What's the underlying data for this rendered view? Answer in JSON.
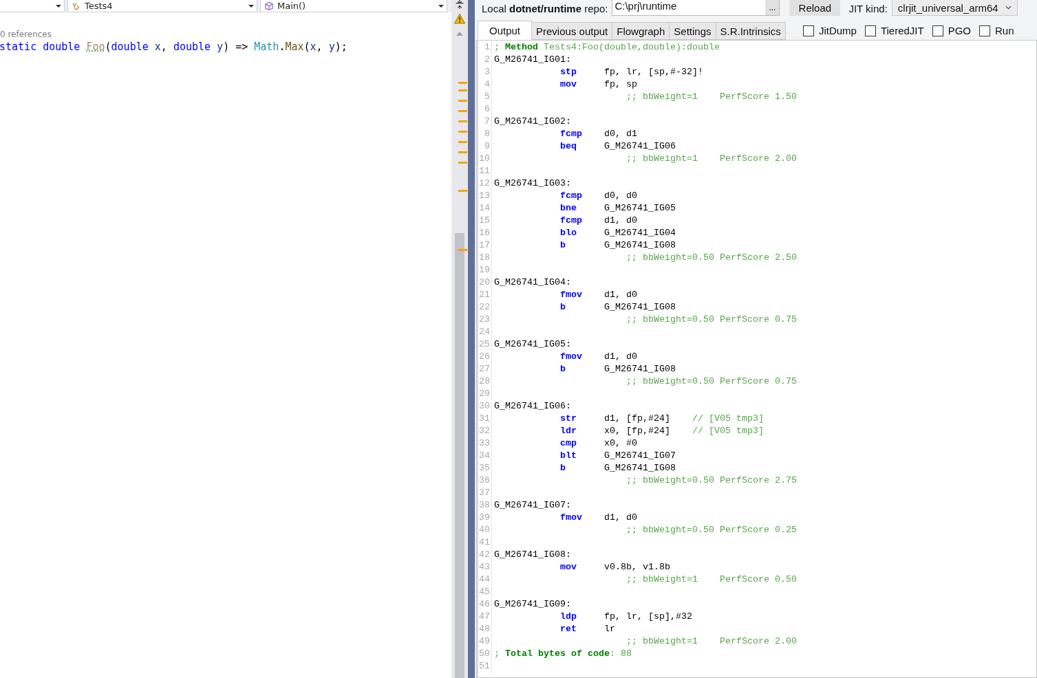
{
  "editor": {
    "nav": [
      {
        "label": "Tests4",
        "kind": "class"
      },
      {
        "label": "Main()",
        "kind": "method"
      }
    ],
    "codelens": "0 references",
    "code": [
      {
        "kind": "keyword",
        "text": "static double "
      },
      {
        "kind": "unused",
        "text": "Foo"
      },
      {
        "kind": "plain",
        "text": "("
      },
      {
        "kind": "keyword",
        "text": "double"
      },
      {
        "kind": "param",
        "text": " x"
      },
      {
        "kind": "plain",
        "text": ", "
      },
      {
        "kind": "keyword",
        "text": "double"
      },
      {
        "kind": "param",
        "text": " y"
      },
      {
        "kind": "plain",
        "text": ") => "
      },
      {
        "kind": "type",
        "text": "Math"
      },
      {
        "kind": "plain",
        "text": "."
      },
      {
        "kind": "method",
        "text": "Max"
      },
      {
        "kind": "plain",
        "text": "("
      },
      {
        "kind": "param",
        "text": "x"
      },
      {
        "kind": "plain",
        "text": ", "
      },
      {
        "kind": "param",
        "text": "y"
      },
      {
        "kind": "plain",
        "text": ");"
      }
    ]
  },
  "jit": {
    "repo_label": "Local **dotnet/runtime** repo:",
    "repo_value": "C:\\prj\\runtime",
    "browse": "...",
    "reload": "Reload",
    "jit_kind_label": "JIT kind:",
    "jit_kind": "clrjit_universal_arm64",
    "tabs": [
      {
        "label": "Output",
        "selected": true
      },
      {
        "label": "Previous output",
        "selected": false
      },
      {
        "label": "Flowgraph",
        "selected": false
      },
      {
        "label": "Settings",
        "selected": false
      },
      {
        "label": "S.R.Intrinsics",
        "selected": false
      }
    ],
    "options": [
      {
        "label": "JitDump",
        "checked": false
      },
      {
        "label": "TieredJIT",
        "checked": false
      },
      {
        "label": "PGO",
        "checked": false
      },
      {
        "label": "Run",
        "checked": false
      }
    ]
  },
  "listing": [
    {
      "num": "1",
      "kind": "header",
      "mark": ";",
      "keyword": "Method",
      "rest": " Tests4:Foo(double,double):double"
    },
    {
      "num": "2",
      "kind": "label",
      "text": "G_M26741_IG01:"
    },
    {
      "num": "3",
      "kind": "instr",
      "op": "stp",
      "args": "fp, lr, [sp,#-32]!"
    },
    {
      "num": "4",
      "kind": "instr",
      "op": "mov",
      "args": "fp, sp"
    },
    {
      "num": "5",
      "kind": "score",
      "text": ";; bbWeight=1    PerfScore 1.50"
    },
    {
      "num": "6",
      "kind": "blank"
    },
    {
      "num": "7",
      "kind": "label",
      "text": "G_M26741_IG02:"
    },
    {
      "num": "8",
      "kind": "instr",
      "op": "fcmp",
      "args": "d0, d1"
    },
    {
      "num": "9",
      "kind": "instr",
      "op": "beq",
      "args": "G_M26741_IG06"
    },
    {
      "num": "10",
      "kind": "score",
      "text": ";; bbWeight=1    PerfScore 2.00"
    },
    {
      "num": "11",
      "kind": "blank"
    },
    {
      "num": "12",
      "kind": "label",
      "text": "G_M26741_IG03:"
    },
    {
      "num": "13",
      "kind": "instr",
      "op": "fcmp",
      "args": "d0, d0"
    },
    {
      "num": "14",
      "kind": "instr",
      "op": "bne",
      "args": "G_M26741_IG05"
    },
    {
      "num": "15",
      "kind": "instr",
      "op": "fcmp",
      "args": "d1, d0"
    },
    {
      "num": "16",
      "kind": "instr",
      "op": "blo",
      "args": "G_M26741_IG04"
    },
    {
      "num": "17",
      "kind": "instr",
      "op": "b",
      "args": "G_M26741_IG08"
    },
    {
      "num": "18",
      "kind": "score",
      "text": ";; bbWeight=0.50 PerfScore 2.50"
    },
    {
      "num": "19",
      "kind": "blank"
    },
    {
      "num": "20",
      "kind": "label",
      "text": "G_M26741_IG04:"
    },
    {
      "num": "21",
      "kind": "instr",
      "op": "fmov",
      "args": "d1, d0"
    },
    {
      "num": "22",
      "kind": "instr",
      "op": "b",
      "args": "G_M26741_IG08"
    },
    {
      "num": "23",
      "kind": "score",
      "text": ";; bbWeight=0.50 PerfScore 0.75"
    },
    {
      "num": "24",
      "kind": "blank"
    },
    {
      "num": "25",
      "kind": "label",
      "text": "G_M26741_IG05:"
    },
    {
      "num": "26",
      "kind": "instr",
      "op": "fmov",
      "args": "d1, d0"
    },
    {
      "num": "27",
      "kind": "instr",
      "op": "b",
      "args": "G_M26741_IG08"
    },
    {
      "num": "28",
      "kind": "score",
      "text": ";; bbWeight=0.50 PerfScore 0.75"
    },
    {
      "num": "29",
      "kind": "blank"
    },
    {
      "num": "30",
      "kind": "label",
      "text": "G_M26741_IG06:"
    },
    {
      "num": "31",
      "kind": "instr",
      "op": "str",
      "args": "d1, [fp,#24]",
      "comment": "// [V05 tmp3]"
    },
    {
      "num": "32",
      "kind": "instr",
      "op": "ldr",
      "args": "x0, [fp,#24]",
      "comment": "// [V05 tmp3]"
    },
    {
      "num": "33",
      "kind": "instr",
      "op": "cmp",
      "args": "x0, #0"
    },
    {
      "num": "34",
      "kind": "instr",
      "op": "blt",
      "args": "G_M26741_IG07"
    },
    {
      "num": "35",
      "kind": "instr",
      "op": "b",
      "args": "G_M26741_IG08"
    },
    {
      "num": "36",
      "kind": "score",
      "text": ";; bbWeight=0.50 PerfScore 2.75"
    },
    {
      "num": "37",
      "kind": "blank"
    },
    {
      "num": "38",
      "kind": "label",
      "text": "G_M26741_IG07:"
    },
    {
      "num": "39",
      "kind": "instr",
      "op": "fmov",
      "args": "d1, d0"
    },
    {
      "num": "40",
      "kind": "score",
      "text": ";; bbWeight=0.50 PerfScore 0.25"
    },
    {
      "num": "41",
      "kind": "blank"
    },
    {
      "num": "42",
      "kind": "label",
      "text": "G_M26741_IG08:"
    },
    {
      "num": "43",
      "kind": "instr",
      "op": "mov",
      "args": "v0.8b, v1.8b"
    },
    {
      "num": "44",
      "kind": "score",
      "text": ";; bbWeight=1    PerfScore 0.50"
    },
    {
      "num": "45",
      "kind": "blank"
    },
    {
      "num": "46",
      "kind": "label",
      "text": "G_M26741_IG09:"
    },
    {
      "num": "47",
      "kind": "instr",
      "op": "ldp",
      "args": "fp, lr, [sp],#32"
    },
    {
      "num": "48",
      "kind": "instr",
      "op": "ret",
      "args": "lr"
    },
    {
      "num": "49",
      "kind": "score",
      "text": ";; bbWeight=1    PerfScore 2.00"
    },
    {
      "num": "50",
      "kind": "header",
      "mark": ";",
      "keyword": "Total bytes of code",
      "rest": ": 88"
    },
    {
      "num": "51",
      "kind": "blank"
    }
  ]
}
